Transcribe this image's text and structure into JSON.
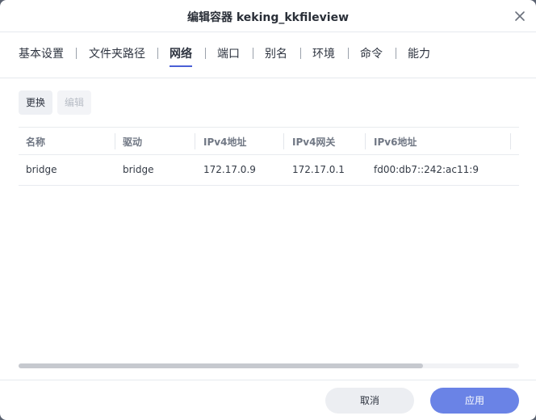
{
  "dialog": {
    "title": "编辑容器 keking_kkfileview"
  },
  "tabs": [
    {
      "label": "基本设置",
      "active": false
    },
    {
      "label": "文件夹路径",
      "active": false
    },
    {
      "label": "网络",
      "active": true
    },
    {
      "label": "端口",
      "active": false
    },
    {
      "label": "别名",
      "active": false
    },
    {
      "label": "环境",
      "active": false
    },
    {
      "label": "命令",
      "active": false
    },
    {
      "label": "能力",
      "active": false
    }
  ],
  "toolbar": {
    "replace_label": "更换",
    "edit_label": "编辑"
  },
  "table": {
    "columns": [
      "名称",
      "驱动",
      "IPv4地址",
      "IPv4网关",
      "IPv6地址"
    ],
    "rows": [
      [
        "bridge",
        "bridge",
        "172.17.0.9",
        "172.17.0.1",
        "fd00:db7::242:ac11:9"
      ]
    ]
  },
  "scrollbar": {
    "position_fraction": 0.0,
    "visible_fraction": 0.808
  },
  "footer": {
    "cancel_label": "取消",
    "apply_label": "应用"
  },
  "colors": {
    "accent": "#4a5fd6",
    "apply_button": "#6a83e6"
  },
  "icons": {
    "close": "close-icon"
  }
}
